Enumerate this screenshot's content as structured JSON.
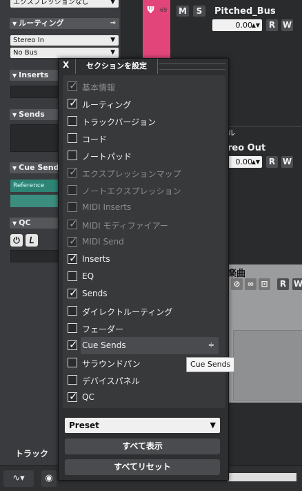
{
  "inspector": {
    "expression": "エクスプレッションなし",
    "routing_title": "ルーティング",
    "routing_input": "Stereo In",
    "routing_output": "No Bus",
    "inserts_title": "Inserts",
    "sends_title": "Sends",
    "cuesends_title": "Cue Sends",
    "cue_reference": "Reference",
    "qc_title": "QC",
    "track_label": "トラック"
  },
  "tracks": {
    "track1": {
      "number": "69",
      "name": "Pitched_Bus",
      "mute": "M",
      "solo": "S",
      "volume": "0.00",
      "read": "R",
      "write": "W"
    },
    "track2": {
      "name_partial": "reo Out",
      "header_partial": "ル",
      "volume": "0.00",
      "read": "R",
      "write": "W"
    },
    "track3": {
      "name_partial": "楽曲",
      "read": "R",
      "write": "W"
    }
  },
  "popup": {
    "close": "X",
    "title": "セクションを設定",
    "options": [
      {
        "label": "基本情報",
        "checked": true,
        "disabled": true
      },
      {
        "label": "ルーティング",
        "checked": true,
        "disabled": false
      },
      {
        "label": "トラックバージョン",
        "checked": false,
        "disabled": false
      },
      {
        "label": "コード",
        "checked": false,
        "disabled": false
      },
      {
        "label": "ノートパッド",
        "checked": false,
        "disabled": false
      },
      {
        "label": "エクスプレッションマップ",
        "checked": true,
        "disabled": true
      },
      {
        "label": "ノートエクスプレッション",
        "checked": false,
        "disabled": true
      },
      {
        "label": "MIDI Inserts",
        "checked": false,
        "disabled": true
      },
      {
        "label": "MIDI モディファイアー",
        "checked": true,
        "disabled": true
      },
      {
        "label": "MIDI Send",
        "checked": true,
        "disabled": true
      },
      {
        "label": "Inserts",
        "checked": true,
        "disabled": false
      },
      {
        "label": "EQ",
        "checked": false,
        "disabled": false
      },
      {
        "label": "Sends",
        "checked": true,
        "disabled": false
      },
      {
        "label": "ダイレクトルーティング",
        "checked": false,
        "disabled": false
      },
      {
        "label": "フェーダー",
        "checked": false,
        "disabled": false
      },
      {
        "label": "Cue Sends",
        "checked": true,
        "disabled": false,
        "highlighted": true
      },
      {
        "label": "サラウンドパン",
        "checked": false,
        "disabled": false
      },
      {
        "label": "デバイスパネル",
        "checked": false,
        "disabled": false
      },
      {
        "label": "QC",
        "checked": true,
        "disabled": false
      }
    ],
    "preset_label": "Preset",
    "show_all": "すべて表示",
    "reset_all": "すべてリセット"
  },
  "tooltip": "Cue Sends"
}
